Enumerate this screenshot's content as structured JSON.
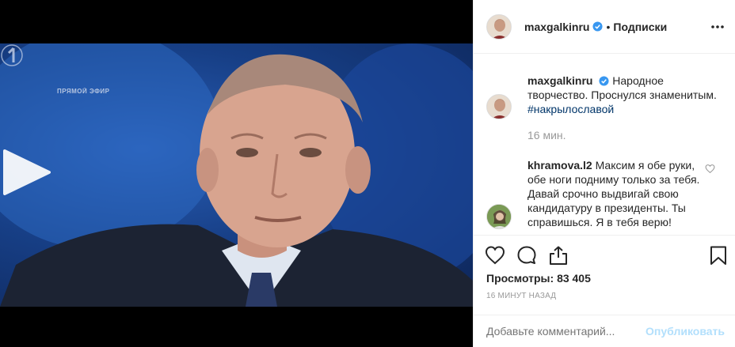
{
  "video": {
    "live_label": "ПРЯМОЙ ЭФИР",
    "icons": [
      "play-icon",
      "channel-one-logo"
    ]
  },
  "header": {
    "username": "maxgalkinru",
    "separator": "•",
    "follow_label": "Подписки",
    "icons": [
      "verified-badge-icon",
      "more-icon"
    ]
  },
  "caption": {
    "username": "maxgalkinru",
    "text": "Народное творчество. Проснулся знаменитым.",
    "hashtag": "#накрылославой",
    "time_ago": "16 мин."
  },
  "comment": {
    "username": "khramova.l2",
    "text": "Максим я обе руки, обе ноги подниму только за тебя. Давай срочно выдвигай свою кандидатуру в президенты. Ты справишься. Я в тебя верю!"
  },
  "actions": {
    "icons": [
      "heart-icon",
      "comment-icon",
      "share-icon",
      "bookmark-icon"
    ]
  },
  "stats": {
    "views_label": "Просмотры:",
    "views_count": "83 405",
    "posted_ago": "16 МИНУТ НАЗАД"
  },
  "add_comment": {
    "placeholder": "Добавьте комментарий...",
    "post_label": "Опубликовать"
  },
  "colors": {
    "link": "#003569",
    "verified": "#3897f0",
    "muted": "#999999",
    "post_disabled": "#b2dffc"
  }
}
